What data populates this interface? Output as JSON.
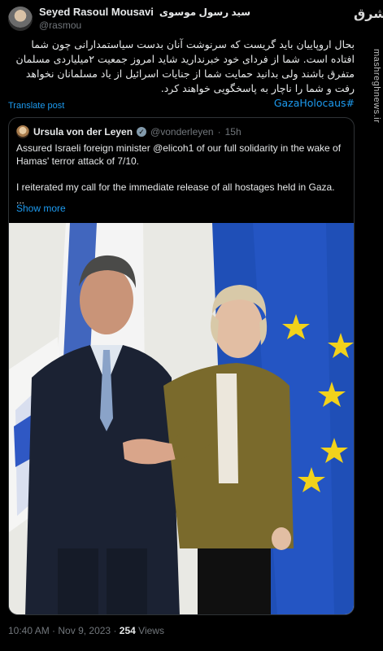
{
  "author": {
    "display_name": "Seyed Rasoul Mousavi",
    "display_name_fa": "سید رسول موسوی",
    "handle": "@rasmou"
  },
  "post": {
    "text": "بحال اروپاییان باید گریست که سرنوشت آنان بدست سیاستمدارانی چون شما افتاده است. شما از فردای خود خبرندارید شاید امروز جمعیت ۲میلیاردی مسلمان متفرق باشند ولی بدانید حمایت شما از جنایات اسرائیل از یاد مسلمانان نخواهد رفت و شما را ناچار به پاسخگویی خواهند کرد.",
    "hashtag": "#GazaHolocaus",
    "translate_label": "Translate post"
  },
  "quote": {
    "display_name": "Ursula von der Leyen",
    "handle": "@vonderleyen",
    "separator": "·",
    "time": "15h",
    "line1": "Assured Israeli foreign minister @elicoh1 of our full solidarity in the wake of Hamas' terror attack of 7/10.",
    "line2": "I reiterated my call for the immediate release of all hostages held in Gaza.",
    "ellipsis": "...",
    "show_more": "Show more"
  },
  "footer": {
    "time": "10:40 AM",
    "date": "Nov 9, 2023",
    "views_count": "254",
    "views_label": "Views"
  },
  "watermark": {
    "logo_text": "مشرق",
    "site": "mashreghnews.ir"
  },
  "colors": {
    "background": "#000000",
    "text": "#e7e9ea",
    "secondary": "#71767b",
    "link": "#1d9bf0",
    "border": "#2f3336",
    "eu_blue": "#1f4fb7",
    "eu_gold": "#f2d21b"
  }
}
